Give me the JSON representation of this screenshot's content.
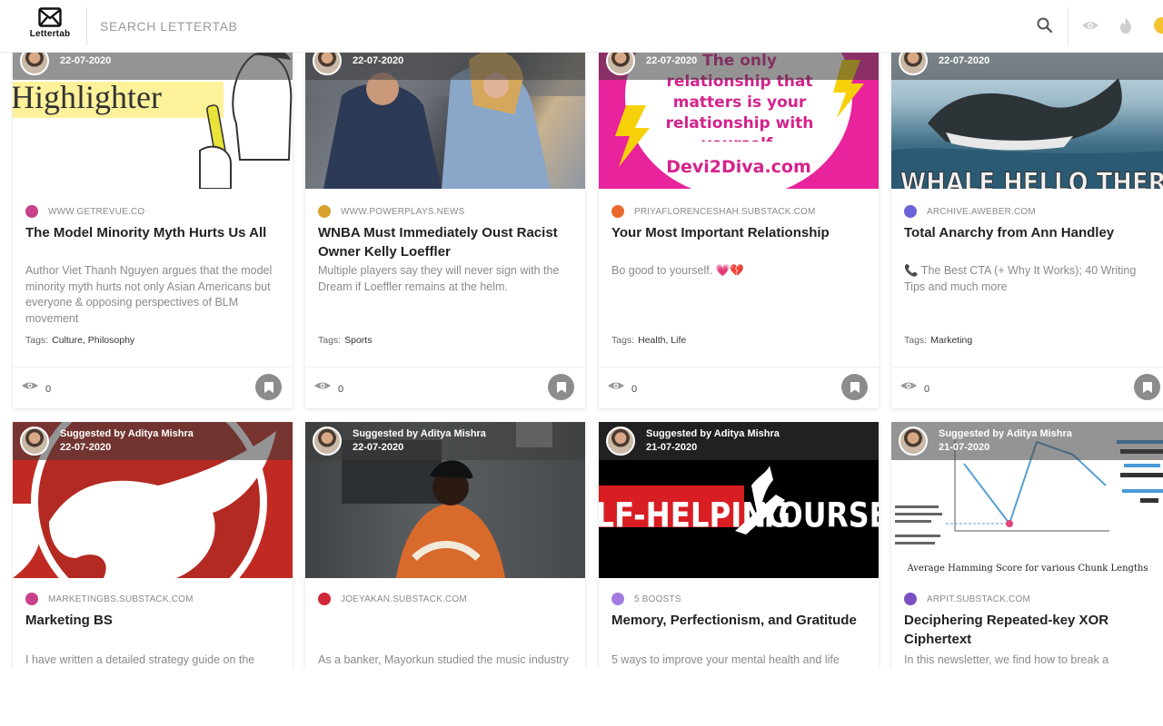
{
  "header": {
    "logo_text": "Lettertab",
    "search_placeholder": "SEARCH LETTERTAB",
    "icons": [
      "search-icon",
      "eye-icon",
      "flame-icon",
      "coin-icon"
    ]
  },
  "colors": {
    "accent": "#f4c430",
    "bookmark": "#8c8c8c"
  },
  "cards": [
    {
      "date": "22-07-2020",
      "source": "WWW.GETREVUE.CO",
      "title": "The Model Minority Myth Hurts Us All",
      "description": "Author Viet Thanh Nguyen argues that the model minority myth hurts not only Asian Americans but everyone & opposing perspectives of BLM movement",
      "tags_label": "Tags:",
      "tags": "Culture, Philosophy",
      "views": "0",
      "image_text": "Highlighter"
    },
    {
      "date": "22-07-2020",
      "source": "WWW.POWERPLAYS.NEWS",
      "title": "WNBA Must Immediately Oust Racist Owner Kelly Loeffler",
      "description": "Multiple players say they will never sign with the Dream if Loeffler remains at the helm.",
      "tags_label": "Tags:",
      "tags": "Sports",
      "views": "0"
    },
    {
      "date": "22-07-2020",
      "source": "PRIYAFLORENCESHAH.SUBSTACK.COM",
      "title": "Your Most Important Relationship",
      "description": "Bo good to yourself. 💗💔",
      "tags_label": "Tags:",
      "tags": "Health, Life",
      "views": "0",
      "image_text_1": "The only relationship that matters is your relationship with yourself.",
      "image_text_2": "Devi2Diva.com"
    },
    {
      "date": "22-07-2020",
      "source": "ARCHIVE.AWEBER.COM",
      "title": "Total Anarchy from Ann Handley",
      "description": "📞 The Best CTA (+ Why It Works); 40 Writing Tips and much more",
      "tags_label": "Tags:",
      "tags": "Marketing",
      "views": "0",
      "image_text": "WHALE HELLO THERE"
    },
    {
      "suggested": "Suggested by Aditya Mishra",
      "date": "22-07-2020",
      "source": "MARKETINGBS.SUBSTACK.COM",
      "title": "Marketing BS",
      "description": "I have written a detailed strategy guide on the path to reaching $1 million in annual"
    },
    {
      "suggested": "Suggested by Aditya Mishra",
      "date": "22-07-2020",
      "source": "JOEYAKAN.SUBSTACK.COM",
      "title": "",
      "description": "As a banker, Mayorkun studied the music industry for trends and shifts in consumer"
    },
    {
      "suggested": "Suggested by Aditya Mishra",
      "date": "21-07-2020",
      "source": "5 BOOSTS",
      "title": "Memory, Perfectionism, and Gratitude",
      "description": "5 ways to improve your mental health and life",
      "image_text_1": "LF-HELPING",
      "image_text_2": "YOURSE"
    },
    {
      "suggested": "Suggested by Aditya Mishra",
      "date": "21-07-2020",
      "source": "ARPIT.SUBSTACK.COM",
      "title": "Deciphering Repeated-key XOR Ciphertext",
      "description": "In this newsletter, we find how to break a Repeating-key XOR cipher with variable key",
      "image_caption": "Average Hamming Score for various Chunk Lengths"
    }
  ]
}
